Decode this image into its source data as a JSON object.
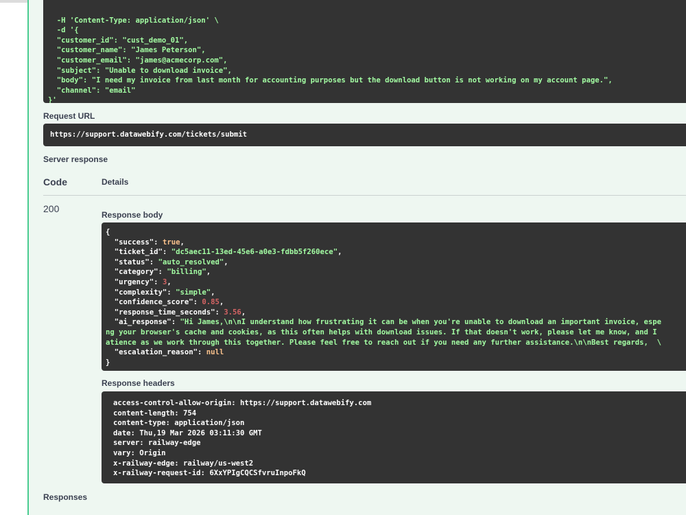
{
  "curl_lines": [
    "  -H 'Content-Type: application/json' \\",
    "  -d '{",
    "  \"customer_id\": \"cust_demo_01\",",
    "  \"customer_name\": \"James Peterson\",",
    "  \"customer_email\": \"james@acmecorp.com\",",
    "  \"subject\": \"Unable to download invoice\",",
    "  \"body\": \"I need my invoice from last month for accounting purposes but the download button is not working on my account page.\",",
    "  \"channel\": \"email\"",
    "}'"
  ],
  "request_url": {
    "label": "Request URL",
    "value": "https://support.datawebify.com/tickets/submit"
  },
  "server_response": {
    "label": "Server response",
    "code_header": "Code",
    "details_header": "Details",
    "status_code": "200"
  },
  "response_body": {
    "label": "Response body",
    "open": "{",
    "close": "}",
    "fields": [
      {
        "key": "\"success\"",
        "value": "true",
        "type": "b",
        "comma": ","
      },
      {
        "key": "\"ticket_id\"",
        "value": "\"dc5aec11-13ed-45e6-a0e3-fdbb5f260ece\"",
        "type": "s",
        "comma": ","
      },
      {
        "key": "\"status\"",
        "value": "\"auto_resolved\"",
        "type": "s",
        "comma": ","
      },
      {
        "key": "\"category\"",
        "value": "\"billing\"",
        "type": "s",
        "comma": ","
      },
      {
        "key": "\"urgency\"",
        "value": "3",
        "type": "n",
        "comma": ","
      },
      {
        "key": "\"complexity\"",
        "value": "\"simple\"",
        "type": "s",
        "comma": ","
      },
      {
        "key": "\"confidence_score\"",
        "value": "0.85",
        "type": "n",
        "comma": ","
      },
      {
        "key": "\"response_time_seconds\"",
        "value": "3.56",
        "type": "n",
        "comma": ","
      },
      {
        "key": "\"ai_response\"",
        "value": "\"Hi James,\\n\\nI understand how frustrating it can be when you're unable to download an important invoice, espe",
        "type": "s",
        "comma": ""
      }
    ],
    "wrap_lines": [
      "ng your browser's cache and cookies, as this often helps with download issues. If that doesn't work, please let me know, and I",
      "atience as we work through this together. Please feel free to reach out if you need any further assistance.\\n\\nBest regards,  \\"
    ],
    "last_field": {
      "key": "\"escalation_reason\"",
      "value": "null",
      "type": "b"
    }
  },
  "response_headers": {
    "label": "Response headers",
    "lines": [
      "access-control-allow-origin: https://support.datawebify.com",
      "content-length: 754",
      "content-type: application/json",
      "date: Thu,19 Mar 2026 03:11:30 GMT",
      "server: railway-edge",
      "vary: Origin",
      "x-railway-edge: railway/us-west2",
      "x-railway-request-id: 6XxYPIgCQCSfvruInpoFkQ"
    ]
  },
  "responses_label": "Responses"
}
